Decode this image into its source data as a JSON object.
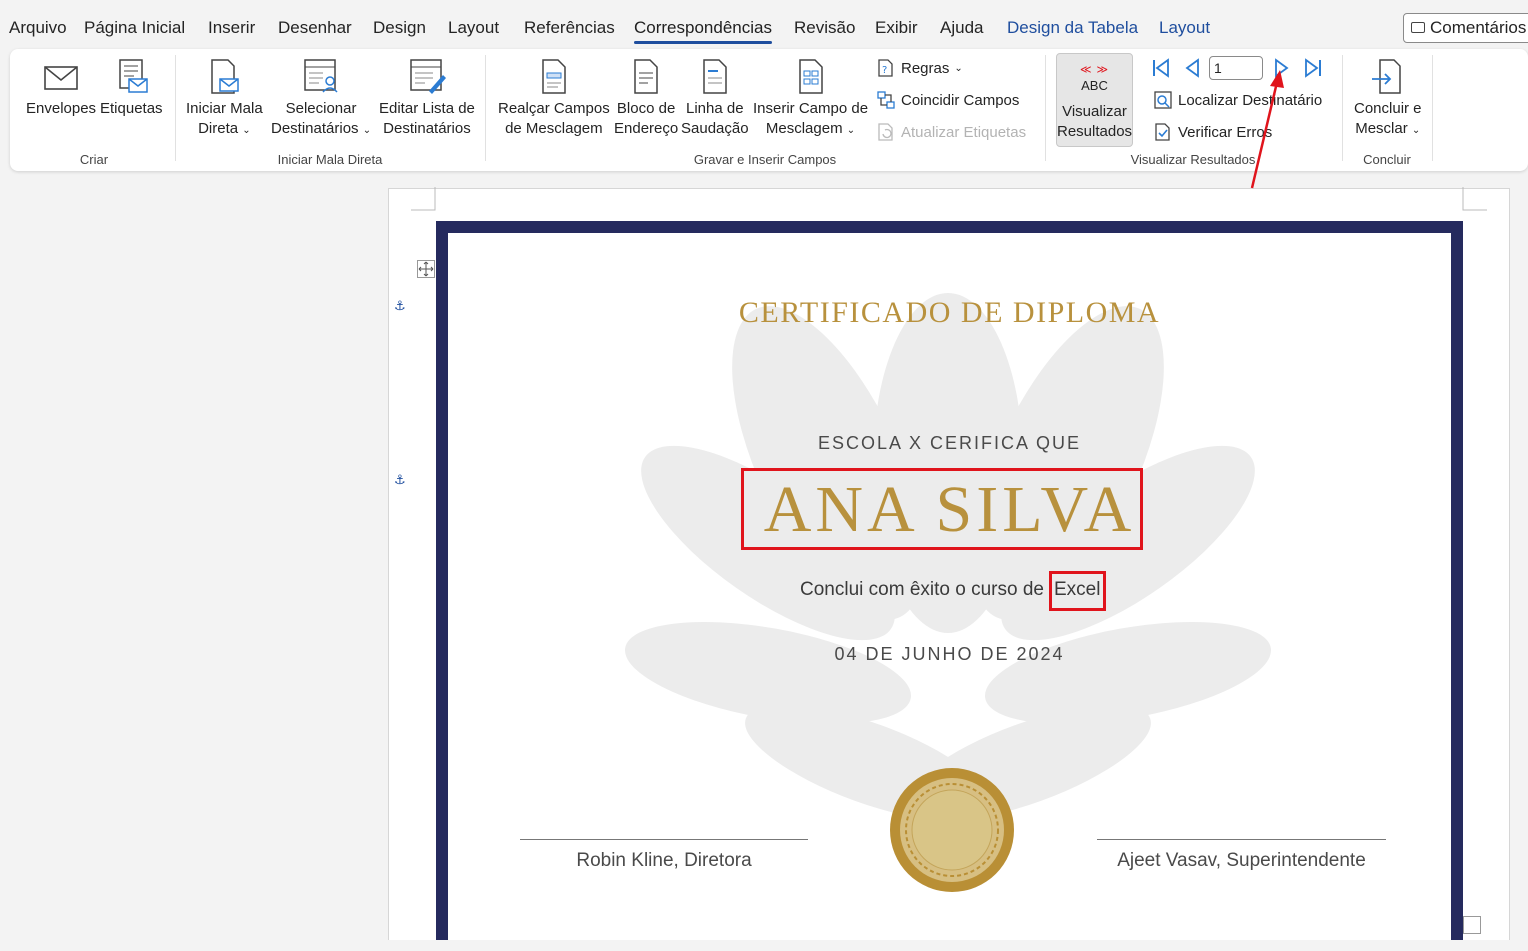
{
  "menu": {
    "tabs": [
      {
        "label": "Arquivo"
      },
      {
        "label": "Página Inicial"
      },
      {
        "label": "Inserir"
      },
      {
        "label": "Desenhar"
      },
      {
        "label": "Design"
      },
      {
        "label": "Layout"
      },
      {
        "label": "Referências"
      },
      {
        "label": "Correspondências"
      },
      {
        "label": "Revisão"
      },
      {
        "label": "Exibir"
      },
      {
        "label": "Ajuda"
      },
      {
        "label": "Design da Tabela"
      },
      {
        "label": "Layout"
      }
    ],
    "active_tab": "Correspondências",
    "comments_label": "Comentários"
  },
  "ribbon": {
    "criar": {
      "label": "Criar",
      "envelopes": "Envelopes",
      "etiquetas": "Etiquetas"
    },
    "iniciar": {
      "label": "Iniciar Mala Direta",
      "iniciar_l1": "Iniciar Mala",
      "iniciar_l2": "Direta",
      "selecionar_l1": "Selecionar",
      "selecionar_l2": "Destinatários",
      "editar_l1": "Editar Lista de",
      "editar_l2": "Destinatários"
    },
    "gravar": {
      "label": "Gravar e Inserir Campos",
      "realcar_l1": "Realçar Campos",
      "realcar_l2": "de Mesclagem",
      "bloco_l1": "Bloco de",
      "bloco_l2": "Endereço",
      "linha_l1": "Linha de",
      "linha_l2": "Saudação",
      "inserir_l1": "Inserir Campo de",
      "inserir_l2": "Mesclagem",
      "regras": "Regras",
      "coincidir": "Coincidir Campos",
      "atualizar": "Atualizar Etiquetas"
    },
    "visualizar": {
      "label": "Visualizar Resultados",
      "abc": "ABC",
      "preview_l1": "Visualizar",
      "preview_l2": "Resultados",
      "record": "1",
      "localizar": "Localizar Destinatário",
      "verificar": "Verificar Erros"
    },
    "concluir": {
      "label": "Concluir",
      "concluir_l1": "Concluir e",
      "concluir_l2": "Mesclar"
    }
  },
  "certificate": {
    "title": "CERTIFICADO DE DIPLOMA",
    "subtitle": "ESCOLA X CERIFICA QUE",
    "name": "ANA SILVA",
    "course_text": "Conclui com êxito o curso de",
    "course_value": "Excel",
    "date": "04 DE JUNHO DE 2024",
    "signer_left": "Robin Kline, Diretora",
    "signer_right": "Ajeet Vasav, Superintendente"
  },
  "colors": {
    "accent": "#1f4e9e",
    "gold": "#b8913d",
    "border_navy": "#252a5e",
    "annotation_red": "#e0141c"
  }
}
